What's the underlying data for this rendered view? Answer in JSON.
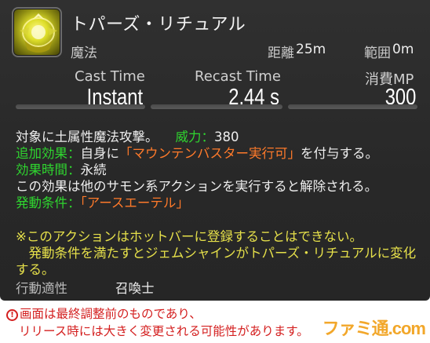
{
  "tooltip": {
    "action_name": "トパーズ・リチュアル",
    "icon": "topaz-ritual-icon",
    "category": "魔法",
    "range_label": "距離",
    "range_value": "25m",
    "radius_label": "範囲",
    "radius_value": "0m",
    "stats": {
      "cast_label": "Cast Time",
      "cast_value": "Instant",
      "recast_label": "Recast Time",
      "recast_value": "2.44 s",
      "cost_label": "消費MP",
      "cost_value": "300"
    },
    "description": {
      "line1_text": "対象に土属性魔法攻撃。",
      "potency_label": "威力：",
      "potency_value": "380",
      "line2_label": "追加効果：",
      "line2_text_a": "自身に",
      "line2_highlight": "「マウンテンバスター実行可」",
      "line2_text_b": "を付与する。",
      "line3_label": "効果時間：",
      "line3_text": "永続",
      "line4_text": "この効果は他のサモン系アクションを実行すると解除される。",
      "line5_label": "発動条件：",
      "line5_highlight": "「アースエーテル」",
      "note1": "※このアクションはホットバーに登録することはできない。",
      "note2": "　発動条件を満たすとジェムシャインがトパーズ・リチュアルに変化",
      "note3": "する。",
      "job_label": "行動適性",
      "job_value": "召喚士"
    },
    "colors": {
      "label_green": "#2fd52f",
      "highlight_orange": "#ff7a2a",
      "note_yellow": "#e6e04a"
    }
  },
  "footer": {
    "warning_icon": "!",
    "line1": "画面は最終調整前のものであり、",
    "line2": "リリース時には大きく変更される可能性があります。",
    "watermark": "ファミ通.com"
  }
}
